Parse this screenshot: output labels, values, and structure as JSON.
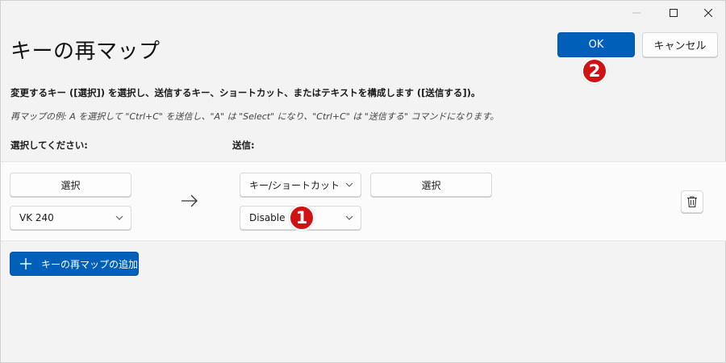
{
  "window": {
    "title": "キーの再マップ"
  },
  "header": {
    "ok_label": "OK",
    "cancel_label": "キャンセル"
  },
  "instructions": {
    "description": "変更するキー ([選択]) を選択し、送信するキー、ショートカット、またはテキストを構成します ([送信する])。",
    "example": "再マップの例: A を選択して \"Ctrl+C\" を送信し、\"A\" は \"Select\" になり、\"Ctrl+C\" は \"送信する\" コマンドになります。"
  },
  "columns": {
    "select_label": "選択してください:",
    "send_label": "送信:"
  },
  "mapping_row": {
    "source_select_label": "選択",
    "source_key_value": "VK 240",
    "target_type_value": "キー/ショートカットの送",
    "target_select_label": "選択",
    "target_key_value": "Disable"
  },
  "footer": {
    "add_label": "キーの再マップの追加"
  },
  "annotations": {
    "badge_1": "1",
    "badge_2": "2"
  },
  "colors": {
    "accent": "#005fb8",
    "badge": "#d01212"
  }
}
